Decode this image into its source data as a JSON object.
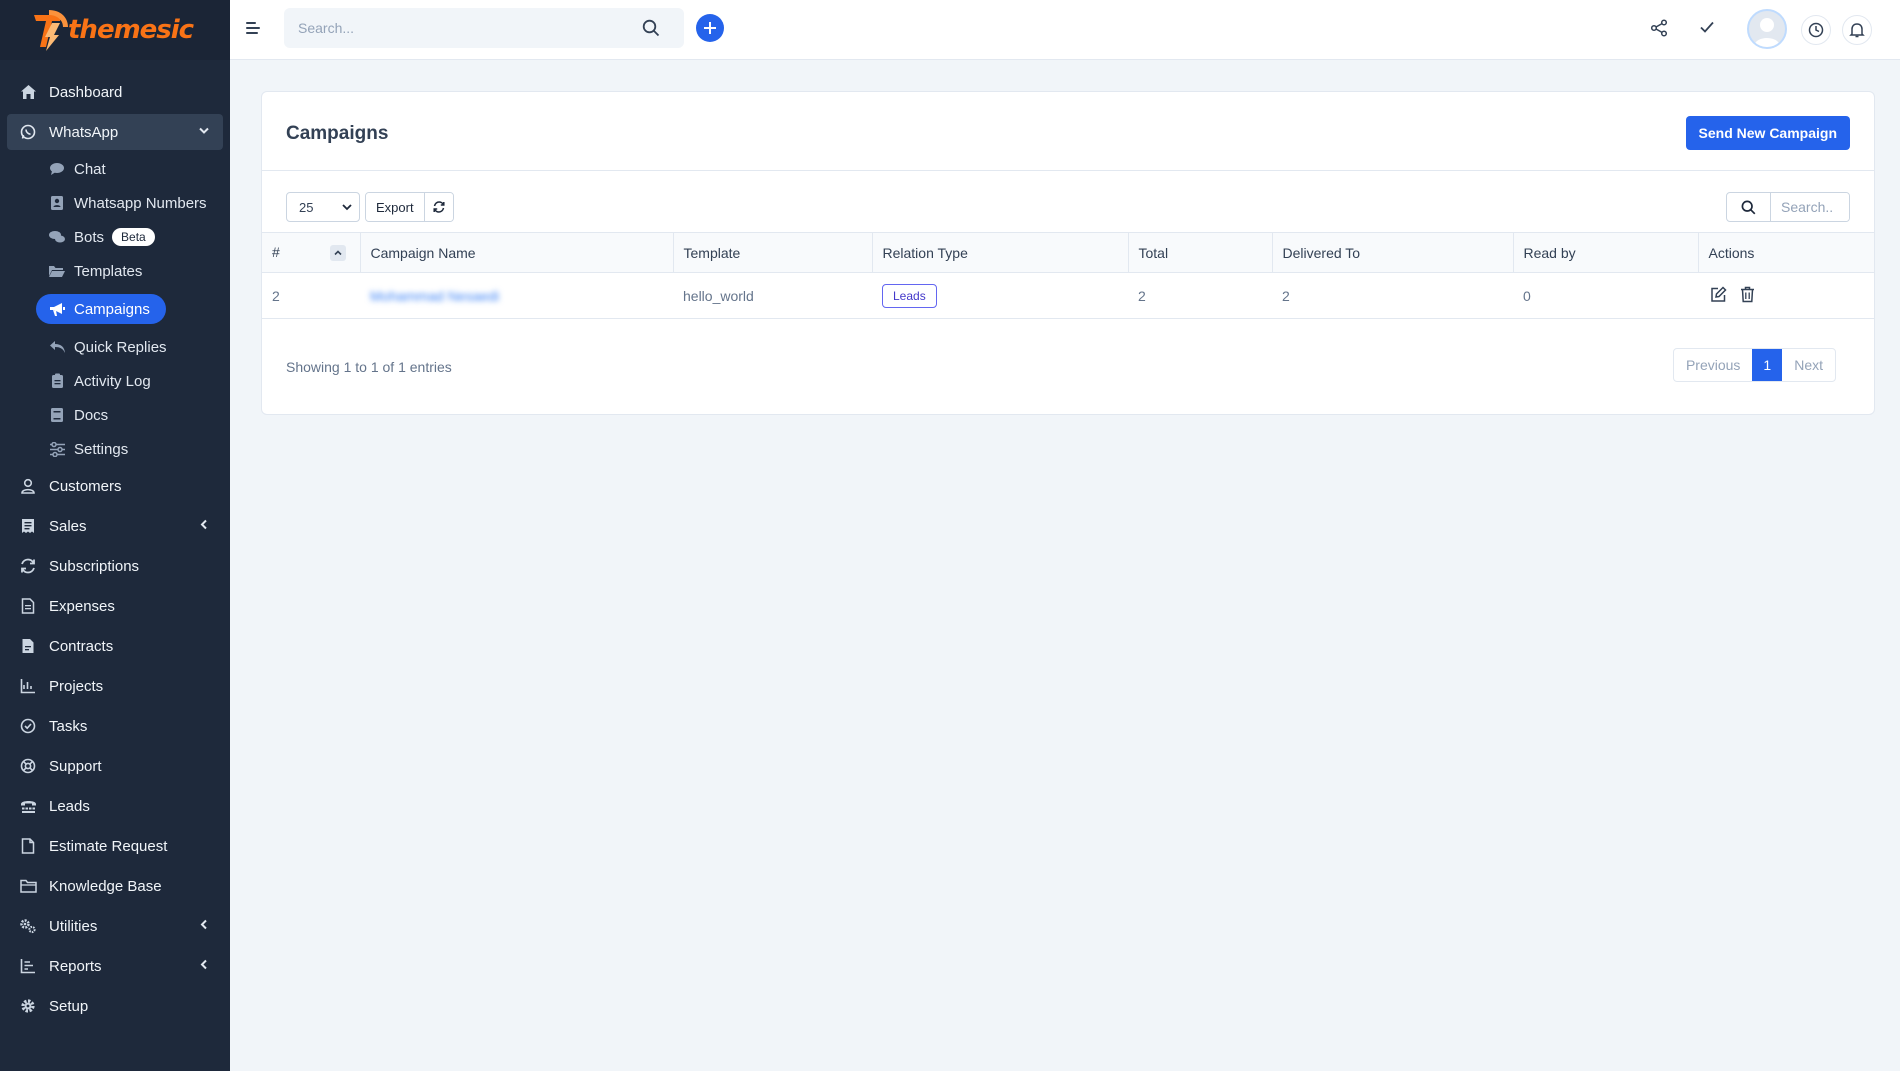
{
  "brand": {
    "name": "themesic"
  },
  "topbar": {
    "search_placeholder": "Search..."
  },
  "sidebar": {
    "items": [
      {
        "label": "Dashboard",
        "icon": "home-icon"
      },
      {
        "label": "WhatsApp",
        "icon": "whatsapp-icon"
      },
      {
        "label": "Customers",
        "icon": "user-icon"
      },
      {
        "label": "Sales",
        "icon": "receipt-icon"
      },
      {
        "label": "Subscriptions",
        "icon": "refresh-icon"
      },
      {
        "label": "Expenses",
        "icon": "file-text-icon"
      },
      {
        "label": "Contracts",
        "icon": "contract-icon"
      },
      {
        "label": "Projects",
        "icon": "chart-icon"
      },
      {
        "label": "Tasks",
        "icon": "check-circle-icon"
      },
      {
        "label": "Support",
        "icon": "lifebuoy-icon"
      },
      {
        "label": "Leads",
        "icon": "tty-icon"
      },
      {
        "label": "Estimate Request",
        "icon": "file-icon"
      },
      {
        "label": "Knowledge Base",
        "icon": "folder-icon"
      },
      {
        "label": "Utilities",
        "icon": "cogs-icon"
      },
      {
        "label": "Reports",
        "icon": "bar-chart-icon"
      },
      {
        "label": "Setup",
        "icon": "gear-icon"
      }
    ],
    "whatsapp_sub": [
      {
        "label": "Chat",
        "icon": "comment-icon"
      },
      {
        "label": "Whatsapp Numbers",
        "icon": "address-book-icon"
      },
      {
        "label": "Bots",
        "icon": "comments-icon",
        "badge": "Beta"
      },
      {
        "label": "Templates",
        "icon": "folder-open-icon"
      },
      {
        "label": "Campaigns",
        "icon": "bullhorn-icon"
      },
      {
        "label": "Quick Replies",
        "icon": "reply-icon"
      },
      {
        "label": "Activity Log",
        "icon": "clipboard-icon"
      },
      {
        "label": "Docs",
        "icon": "book-icon"
      },
      {
        "label": "Settings",
        "icon": "sliders-icon"
      }
    ]
  },
  "page": {
    "title": "Campaigns",
    "new_button": "Send New Campaign",
    "page_length": "25",
    "export_label": "Export",
    "search_placeholder": "Search..",
    "columns": [
      "#",
      "Campaign Name",
      "Template",
      "Relation Type",
      "Total",
      "Delivered To",
      "Read by",
      "Actions"
    ],
    "rows": [
      {
        "id": "2",
        "campaign_name": "Mohammad Nesaedi",
        "template": "hello_world",
        "relation_type": "Leads",
        "total": "2",
        "delivered_to": "2",
        "read_by": "0"
      }
    ],
    "info": "Showing 1 to 1 of 1 entries",
    "pager": {
      "previous": "Previous",
      "current": "1",
      "next": "Next"
    }
  },
  "colors": {
    "sidebar_bg": "#1e293b",
    "accent": "#2563eb",
    "brand_orange": "#f97316"
  }
}
